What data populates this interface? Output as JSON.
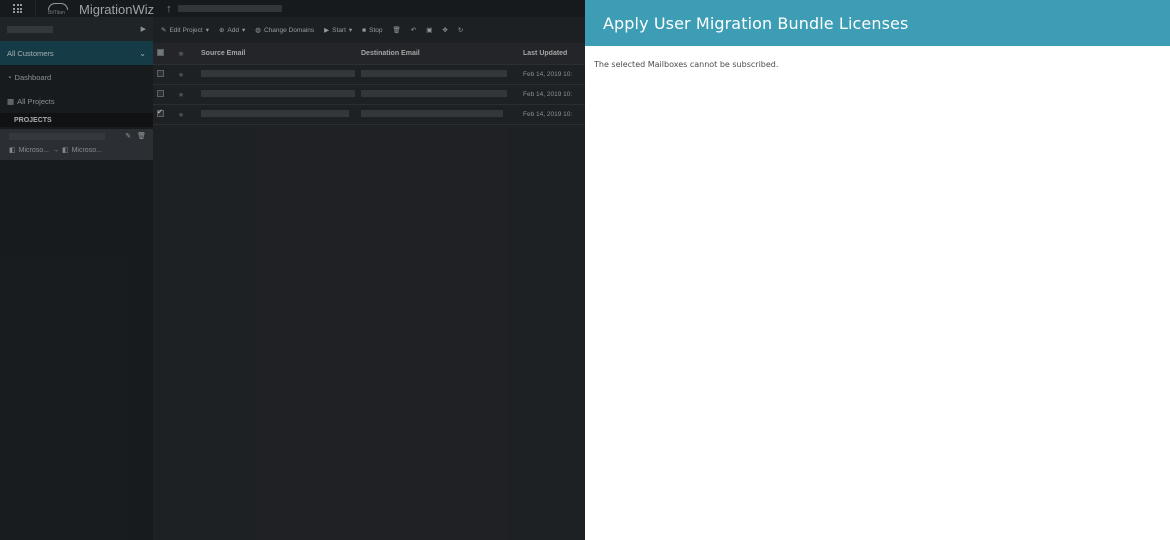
{
  "app": {
    "name": "MigrationWiz",
    "brand_sub": "BitTitan"
  },
  "sidebar": {
    "all_customers": "All Customers",
    "dashboard": "Dashboard",
    "all_projects": "All Projects",
    "projects_header": "PROJECTS",
    "project": {
      "source": "Microso...",
      "destination": "Microso..."
    }
  },
  "toolbar": {
    "edit_project": "Edit Project",
    "add": "Add",
    "change_domains": "Change Domains",
    "start": "Start",
    "stop": "Stop"
  },
  "grid": {
    "columns": {
      "source": "Source Email",
      "destination": "Destination Email",
      "last_updated": "Last Updated"
    },
    "rows": [
      {
        "last_updated": "Feb 14, 2019 10:",
        "checked": false
      },
      {
        "last_updated": "Feb 14, 2019 10:",
        "checked": false
      },
      {
        "last_updated": "Feb 14, 2019 10:",
        "checked": true
      }
    ]
  },
  "panel": {
    "title": "Apply User Migration Bundle Licenses",
    "message": "The selected Mailboxes cannot be subscribed."
  },
  "colors": {
    "panel_header": "#3c9db4",
    "sidebar_active": "#1d4f5e"
  }
}
